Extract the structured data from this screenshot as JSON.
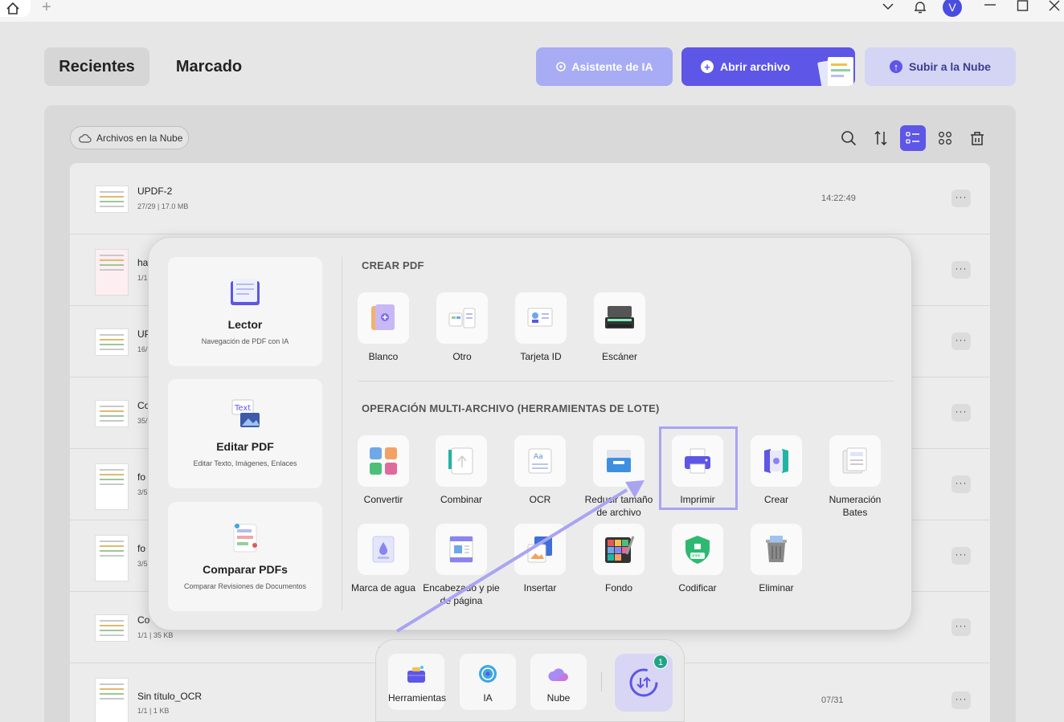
{
  "titlebar": {
    "avatar_letter": "V"
  },
  "header": {
    "tabs": [
      {
        "label": "Recientes",
        "active": true
      },
      {
        "label": "Marcado",
        "active": false
      }
    ],
    "ai_button": "Asistente de IA",
    "open_button": "Abrir archivo",
    "cloud_button": "Subir a la Nube"
  },
  "cloud_chip": "Archivos en la Nube",
  "files": [
    {
      "name": "UPDF-2",
      "meta": "27/29 | 17.0 MB",
      "time": "14:22:49"
    },
    {
      "name": "ha",
      "meta": "1/1",
      "time": ""
    },
    {
      "name": "UP",
      "meta": "16/",
      "time": ""
    },
    {
      "name": "Co",
      "meta": "35/",
      "time": ""
    },
    {
      "name": "fo",
      "meta": "3/5",
      "time": ""
    },
    {
      "name": "fo",
      "meta": "3/5",
      "time": ""
    },
    {
      "name": "Co",
      "meta": "1/1 | 35 KB",
      "time": ""
    },
    {
      "name": "Sin título_OCR",
      "meta": "1/1 | 1 KB",
      "time": "07/31"
    }
  ],
  "popup": {
    "cards": [
      {
        "title": "Lector",
        "sub": "Navegación de PDF con IA"
      },
      {
        "title": "Editar PDF",
        "sub": "Editar Texto, Imágenes, Enlaces"
      },
      {
        "title": "Comparar PDFs",
        "sub": "Comparar Revisiones de Documentos"
      }
    ],
    "create_title": "CREAR PDF",
    "create_tools": [
      "Blanco",
      "Otro",
      "Tarjeta ID",
      "Escáner"
    ],
    "batch_title": "OPERACIÓN MULTI-ARCHIVO (HERRAMIENTAS DE LOTE)",
    "batch_tools": [
      "Convertir",
      "Combinar",
      "OCR",
      "Reducir tamaño de archivo",
      "Imprimir",
      "Crear",
      "Numeración Bates",
      "Marca de agua",
      "Encabezado y pie de página",
      "Insertar",
      "Fondo",
      "Codificar",
      "Eliminar"
    ]
  },
  "dock": {
    "items": [
      "Herramientas",
      "IA",
      "Nube"
    ],
    "badge": "1"
  },
  "colors": {
    "accent": "#5d56e6",
    "highlight": "#a9a4f2",
    "badge": "#21a485"
  }
}
